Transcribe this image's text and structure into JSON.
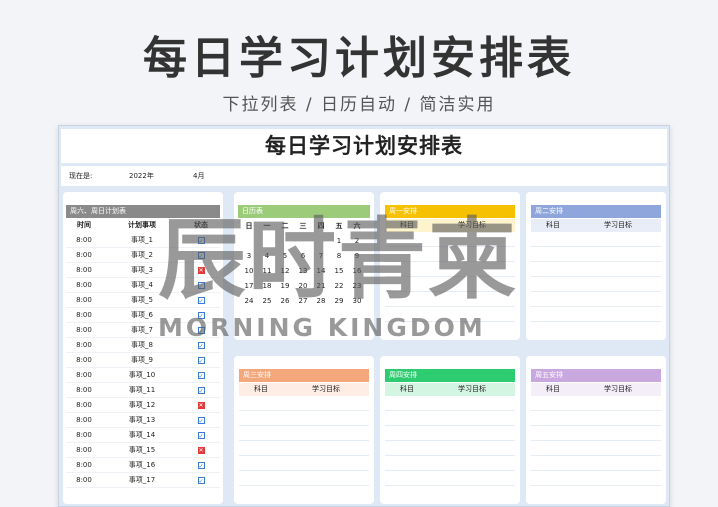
{
  "hero": {
    "title": "每日学习计划安排表",
    "subtitle": "下拉列表 / 日历自动 / 简洁实用"
  },
  "sheet": {
    "title": "每日学习计划安排表"
  },
  "date_row": {
    "label": "现在是:",
    "year": "2022年",
    "month": "4月"
  },
  "daily_plan": {
    "header": "周六、周日计划表",
    "header_color": "#8a8a8a",
    "columns": [
      "时间",
      "计划事项",
      "状态"
    ],
    "rows": [
      {
        "time": "8:00",
        "item": "事项_1",
        "status": "done"
      },
      {
        "time": "8:00",
        "item": "事项_2",
        "status": "done"
      },
      {
        "time": "8:00",
        "item": "事项_3",
        "status": "undone"
      },
      {
        "time": "8:00",
        "item": "事项_4",
        "status": "done"
      },
      {
        "time": "8:00",
        "item": "事项_5",
        "status": "done"
      },
      {
        "time": "8:00",
        "item": "事项_6",
        "status": "done"
      },
      {
        "time": "8:00",
        "item": "事项_7",
        "status": "done"
      },
      {
        "time": "8:00",
        "item": "事项_8",
        "status": "done"
      },
      {
        "time": "8:00",
        "item": "事项_9",
        "status": "done"
      },
      {
        "time": "8:00",
        "item": "事项_10",
        "status": "done"
      },
      {
        "time": "8:00",
        "item": "事项_11",
        "status": "done"
      },
      {
        "time": "8:00",
        "item": "事项_12",
        "status": "undone"
      },
      {
        "time": "8:00",
        "item": "事项_13",
        "status": "done"
      },
      {
        "time": "8:00",
        "item": "事项_14",
        "status": "done"
      },
      {
        "time": "8:00",
        "item": "事项_15",
        "status": "undone"
      },
      {
        "time": "8:00",
        "item": "事项_16",
        "status": "done"
      },
      {
        "time": "8:00",
        "item": "事项_17",
        "status": "done"
      }
    ]
  },
  "calendar": {
    "header": "日历表",
    "header_color": "#9ccc7a",
    "weekdays": [
      "日",
      "一",
      "二",
      "三",
      "四",
      "五",
      "六"
    ],
    "weeks": [
      [
        "",
        "",
        "",
        "",
        "",
        "1",
        "2"
      ],
      [
        "3",
        "4",
        "5",
        "6",
        "7",
        "8",
        "9"
      ],
      [
        "10",
        "11",
        "12",
        "13",
        "14",
        "15",
        "16"
      ],
      [
        "17",
        "18",
        "19",
        "20",
        "21",
        "22",
        "23"
      ],
      [
        "24",
        "25",
        "26",
        "27",
        "28",
        "29",
        "30"
      ]
    ]
  },
  "arrangements": [
    {
      "header": "周一安排",
      "color": "#f5c100",
      "col1": "科目",
      "col2": "学习目标"
    },
    {
      "header": "周二安排",
      "color": "#8fa6dc",
      "col1": "科目",
      "col2": "学习目标"
    },
    {
      "header": "周三安排",
      "color": "#f4a77a",
      "col1": "科目",
      "col2": "学习目标"
    },
    {
      "header": "周四安排",
      "color": "#2ecc71",
      "col1": "科目",
      "col2": "学习目标"
    },
    {
      "header": "周五安排",
      "color": "#c9a8e0",
      "col1": "科目",
      "col2": "学习目标"
    }
  ],
  "watermark": {
    "text": "辰时青柬",
    "subtext": "MORNING KINGDOM"
  }
}
